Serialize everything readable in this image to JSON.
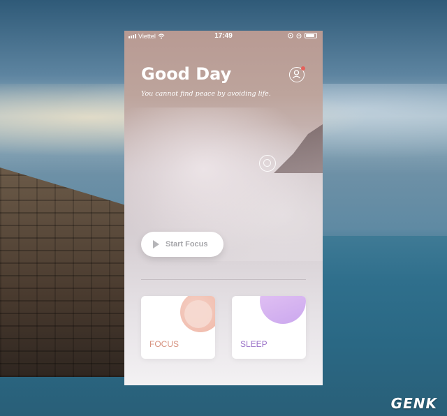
{
  "status_bar": {
    "carrier": "Viettel",
    "time": "17:49"
  },
  "header": {
    "title": "Good Day",
    "subtitle": "You cannot find peace by avoiding life."
  },
  "actions": {
    "start_label": "Start Focus"
  },
  "cards": [
    {
      "label": "FOCUS",
      "accent": "#d79380"
    },
    {
      "label": "SLEEP",
      "accent": "#9a72c8"
    }
  ],
  "watermark": "GENK",
  "colors": {
    "notification_dot": "#e5605a"
  }
}
